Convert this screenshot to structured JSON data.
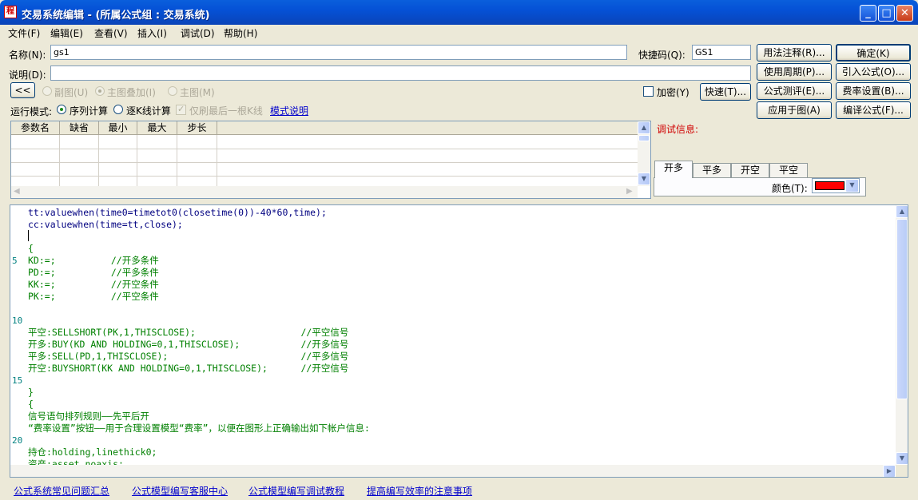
{
  "window": {
    "title": "交易系统编辑 - (所属公式组 : 交易系统)",
    "app_icon_text": "程"
  },
  "menu": [
    "文件(F)",
    "编辑(E)",
    "查看(V)",
    "插入(I)",
    "调试(D)",
    "帮助(H)"
  ],
  "form": {
    "name_label": "名称(N):",
    "name_value": "gs1",
    "shortcut_label": "快捷码(Q):",
    "shortcut_value": "GS1",
    "desc_label": "说明(D):",
    "desc_value": "",
    "collapse_button": "<<",
    "radio_sub": "副图(U)",
    "radio_main_overlay": "主图叠加(I)",
    "radio_main": "主图(M)",
    "encrypt_label": "加密(Y)",
    "quick_button": "快速(T)...",
    "run_mode_label": "运行模式:",
    "run_mode_seq": "序列计算",
    "run_mode_kline": "逐K线计算",
    "only_last_label": "仅刷最后一根K线",
    "mode_help_link": "模式说明"
  },
  "buttons": {
    "usage_notes": "用法注释(R)...",
    "ok": "确定(K)",
    "period": "使用周期(P)...",
    "import_formula": "引入公式(O)...",
    "formula_test": "公式测评(E)...",
    "fee_settings": "费率设置(B)...",
    "apply_chart": "应用于图(A)",
    "compile": "编译公式(F)..."
  },
  "params_grid": {
    "headers": [
      "参数名",
      "缺省",
      "最小",
      "最大",
      "步长"
    ]
  },
  "debug": {
    "label": "调试信息:",
    "tabs": [
      "开多",
      "平多",
      "开空",
      "平空"
    ],
    "color_label": "颜色(T):",
    "color_value": "#ff0000"
  },
  "code_lines": [
    {
      "n": "",
      "t": "tt:valuewhen(time0=timetot0(closetime(0))-40*60,time);"
    },
    {
      "n": "",
      "t": "cc:valuewhen(time=tt,close);"
    },
    {
      "n": "",
      "t": ""
    },
    {
      "n": "",
      "t": "{"
    },
    {
      "n": "5",
      "t": "KD:=;          //开多条件"
    },
    {
      "n": "",
      "t": "PD:=;          //平多条件"
    },
    {
      "n": "",
      "t": "KK:=;          //开空条件"
    },
    {
      "n": "",
      "t": "PK:=;          //平空条件"
    },
    {
      "n": "",
      "t": ""
    },
    {
      "n": "10",
      "t": ""
    },
    {
      "n": "",
      "t": "平空:SELLSHORT(PK,1,THISCLOSE);                   //平空信号"
    },
    {
      "n": "",
      "t": "开多:BUY(KD AND HOLDING=0,1,THISCLOSE);           //开多信号"
    },
    {
      "n": "",
      "t": "平多:SELL(PD,1,THISCLOSE);                        //平多信号"
    },
    {
      "n": "",
      "t": "开空:BUYSHORT(KK AND HOLDING=0,1,THISCLOSE);      //开空信号"
    },
    {
      "n": "15",
      "t": ""
    },
    {
      "n": "",
      "t": "}"
    },
    {
      "n": "",
      "t": "{"
    },
    {
      "n": "",
      "t": "信号语句排列规则——先平后开"
    },
    {
      "n": "",
      "t": "“费率设置”按钮——用于合理设置模型“费率”，以便在图形上正确输出如下帐户信息:"
    },
    {
      "n": "20",
      "t": ""
    },
    {
      "n": "",
      "t": "持仓:holding,linethick0;"
    },
    {
      "n": "",
      "t": "资产:asset,noaxis;"
    }
  ],
  "status_links": [
    "公式系统常见问题汇总",
    "公式模型编写客服中心",
    "公式模型编写调试教程",
    "提高编写效率的注意事项"
  ]
}
